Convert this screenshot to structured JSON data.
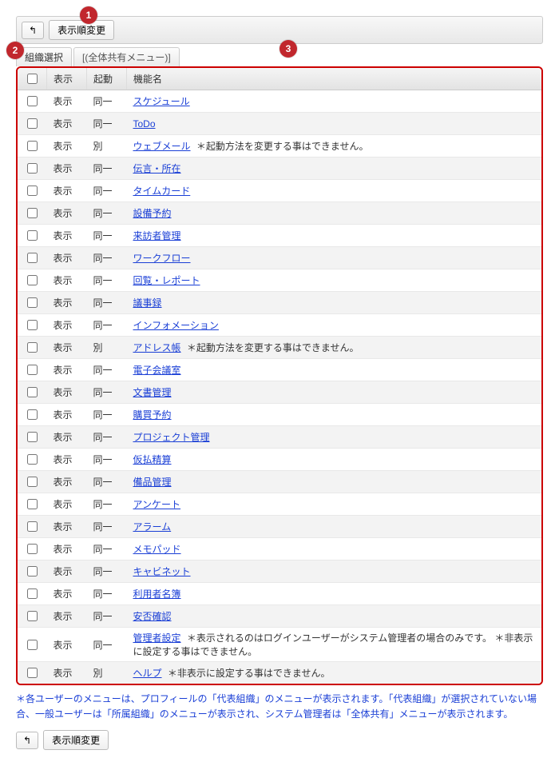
{
  "callouts": {
    "c1": "1",
    "c2": "2",
    "c3": "3"
  },
  "toolbar": {
    "back_icon": "↰",
    "change_order_label": "表示順変更"
  },
  "tabs": {
    "org_select": "組織選択",
    "global_menu": "[(全体共有メニュー)]"
  },
  "table": {
    "headers": {
      "display": "表示",
      "boot": "起動",
      "name": "機能名"
    },
    "rows": [
      {
        "display": "表示",
        "boot": "同一",
        "name": "スケジュール",
        "note": ""
      },
      {
        "display": "表示",
        "boot": "同一",
        "name": "ToDo",
        "note": ""
      },
      {
        "display": "表示",
        "boot": "別",
        "name": "ウェブメール",
        "note": "＊起動方法を変更する事はできません。"
      },
      {
        "display": "表示",
        "boot": "同一",
        "name": "伝言・所在",
        "note": ""
      },
      {
        "display": "表示",
        "boot": "同一",
        "name": "タイムカード",
        "note": ""
      },
      {
        "display": "表示",
        "boot": "同一",
        "name": "設備予約",
        "note": ""
      },
      {
        "display": "表示",
        "boot": "同一",
        "name": "来訪者管理",
        "note": ""
      },
      {
        "display": "表示",
        "boot": "同一",
        "name": "ワークフロー",
        "note": ""
      },
      {
        "display": "表示",
        "boot": "同一",
        "name": "回覧・レポート",
        "note": ""
      },
      {
        "display": "表示",
        "boot": "同一",
        "name": "議事録",
        "note": ""
      },
      {
        "display": "表示",
        "boot": "同一",
        "name": "インフォメーション",
        "note": ""
      },
      {
        "display": "表示",
        "boot": "別",
        "name": "アドレス帳",
        "note": "＊起動方法を変更する事はできません。"
      },
      {
        "display": "表示",
        "boot": "同一",
        "name": "電子会議室",
        "note": ""
      },
      {
        "display": "表示",
        "boot": "同一",
        "name": "文書管理",
        "note": ""
      },
      {
        "display": "表示",
        "boot": "同一",
        "name": "購買予約",
        "note": ""
      },
      {
        "display": "表示",
        "boot": "同一",
        "name": "プロジェクト管理",
        "note": ""
      },
      {
        "display": "表示",
        "boot": "同一",
        "name": "仮払精算",
        "note": ""
      },
      {
        "display": "表示",
        "boot": "同一",
        "name": "備品管理",
        "note": ""
      },
      {
        "display": "表示",
        "boot": "同一",
        "name": "アンケート",
        "note": ""
      },
      {
        "display": "表示",
        "boot": "同一",
        "name": "アラーム",
        "note": ""
      },
      {
        "display": "表示",
        "boot": "同一",
        "name": "メモパッド",
        "note": ""
      },
      {
        "display": "表示",
        "boot": "同一",
        "name": "キャビネット",
        "note": ""
      },
      {
        "display": "表示",
        "boot": "同一",
        "name": "利用者名簿",
        "note": ""
      },
      {
        "display": "表示",
        "boot": "同一",
        "name": "安否確認",
        "note": ""
      },
      {
        "display": "表示",
        "boot": "同一",
        "name": "管理者設定",
        "note": "＊表示されるのはログインユーザーがシステム管理者の場合のみです。 ＊非表示に設定する事はできません。"
      },
      {
        "display": "表示",
        "boot": "別",
        "name": "ヘルプ",
        "note": "＊非表示に設定する事はできません。"
      }
    ]
  },
  "footnote": {
    "body": "＊各ユーザーのメニューは、プロフィールの「代表組織」のメニューが表示されます。「代表組織」が選択されていない場合、一般ユーザーは「所属組織」のメニューが表示され、システム管理者は「全体共有」メニューが表示されます。"
  }
}
